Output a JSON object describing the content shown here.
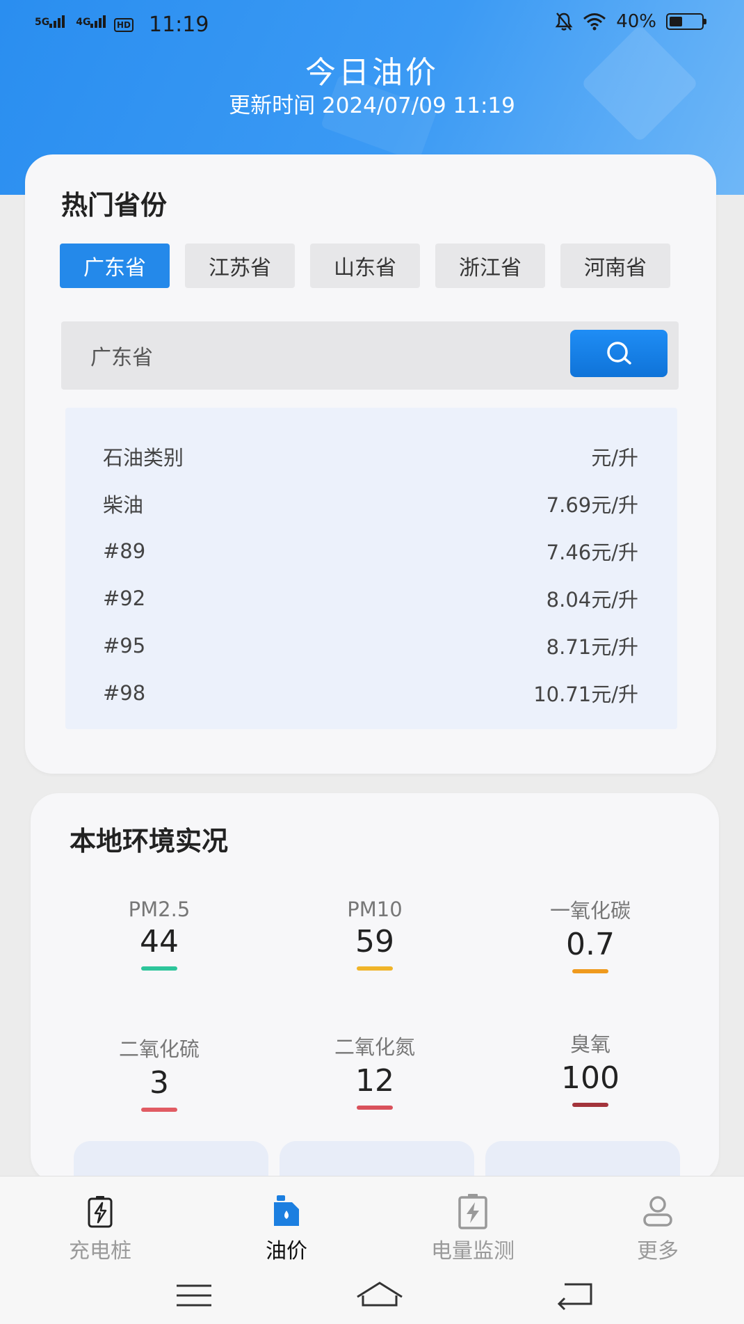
{
  "status_bar": {
    "network1": "5G",
    "network2": "4G",
    "hd": "HD",
    "time": "11:19",
    "battery": "40%",
    "battery_level": 0.4
  },
  "header": {
    "title": "今日油价",
    "update_time": "更新时间 2024/07/09 11:19"
  },
  "hot_provinces": {
    "title": "热门省份",
    "tabs": [
      {
        "label": "广东省",
        "active": true
      },
      {
        "label": "江苏省",
        "active": false
      },
      {
        "label": "山东省",
        "active": false
      },
      {
        "label": "浙江省",
        "active": false
      },
      {
        "label": "河南省",
        "active": false
      }
    ],
    "search": {
      "value": "广东省",
      "placeholder": ""
    },
    "price_header": {
      "category": "石油类别",
      "unit": "元/升"
    },
    "prices": [
      {
        "name": "柴油",
        "price": "7.69元/升"
      },
      {
        "name": "#89",
        "price": "7.46元/升"
      },
      {
        "name": "#92",
        "price": "8.04元/升"
      },
      {
        "name": "#95",
        "price": "8.71元/升"
      },
      {
        "name": "#98",
        "price": "10.71元/升"
      }
    ]
  },
  "environment": {
    "title": "本地环境实况",
    "items": [
      {
        "label": "PM2.5",
        "value": "44",
        "color": "#2dc59b"
      },
      {
        "label": "PM10",
        "value": "59",
        "color": "#f0b429"
      },
      {
        "label": "一氧化碳",
        "value": "0.7",
        "color": "#ef9a1e"
      },
      {
        "label": "二氧化硫",
        "value": "3",
        "color": "#e15b63"
      },
      {
        "label": "二氧化氮",
        "value": "12",
        "color": "#d9515b"
      },
      {
        "label": "臭氧",
        "value": "100",
        "color": "#a3343c"
      }
    ]
  },
  "bottom_nav": [
    {
      "label": "充电桩",
      "icon": "charging-pile-icon",
      "active": false
    },
    {
      "label": "油价",
      "icon": "oil-can-icon",
      "active": true
    },
    {
      "label": "电量监测",
      "icon": "battery-monitor-icon",
      "active": false
    },
    {
      "label": "更多",
      "icon": "user-icon",
      "active": false
    }
  ],
  "colors": {
    "accent": "#2489ea",
    "header_gradient_start": "#2a8ef0",
    "card_bg": "#f7f7f9",
    "table_bg": "#ecf1fb"
  }
}
